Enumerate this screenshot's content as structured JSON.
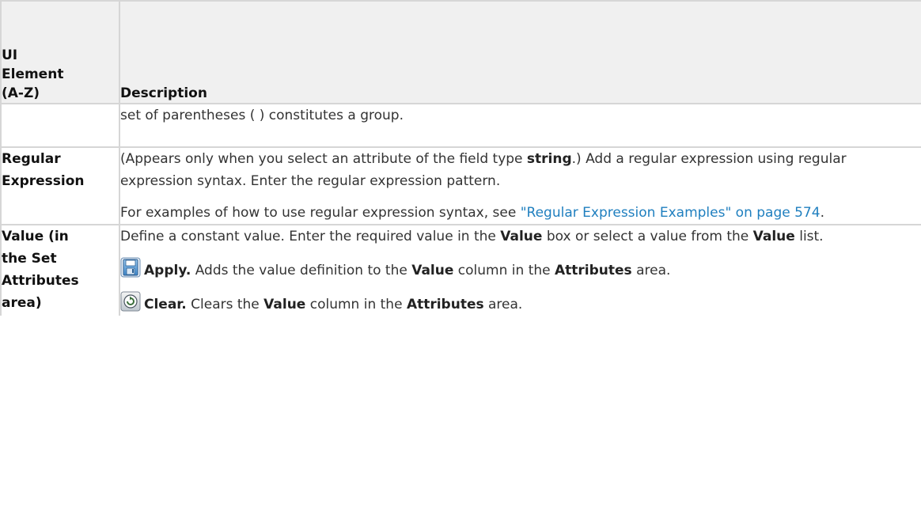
{
  "table": {
    "header": {
      "col1": [
        "UI",
        "Element",
        "(A-Z)"
      ],
      "col2": "Description"
    },
    "row_continuation": {
      "desc": "set of parentheses ( ) constitutes a group."
    },
    "row_regex": {
      "name": [
        "Regular",
        "Expression"
      ],
      "p1_a": "(Appears only when you select an attribute of the field type ",
      "p1_b": "string",
      "p1_c": ".) Add a regular expression using regular expression syntax. Enter the regular expression pattern.",
      "p2_a": "For examples of how to use regular expression syntax, see ",
      "p2_link": "\"Regular Expression Examples\" on page 574",
      "p2_c": "."
    },
    "row_value": {
      "name": [
        "Value (in",
        "the Set",
        "Attributes",
        "area)"
      ],
      "p1_a": "Define a constant value. Enter the required value in the ",
      "p1_b": "Value",
      "p1_c": " box or select a value from the ",
      "p1_d": "Value",
      "p1_e": " list.",
      "apply_label": "Apply.",
      "apply_a": " Adds the value definition to the ",
      "apply_b": "Value",
      "apply_c": " column in the ",
      "apply_d": "Attributes",
      "apply_e": " area.",
      "clear_label": "Clear.",
      "clear_a": " Clears the ",
      "clear_b": "Value",
      "clear_c": " column in the ",
      "clear_d": "Attributes",
      "clear_e": " area."
    }
  },
  "icons": {
    "apply": "save-disk-icon",
    "clear": "clear-refresh-icon"
  },
  "colors": {
    "link": "#1f7fbf",
    "header_bg": "#f0f0f0",
    "border": "#d6d6d6"
  }
}
